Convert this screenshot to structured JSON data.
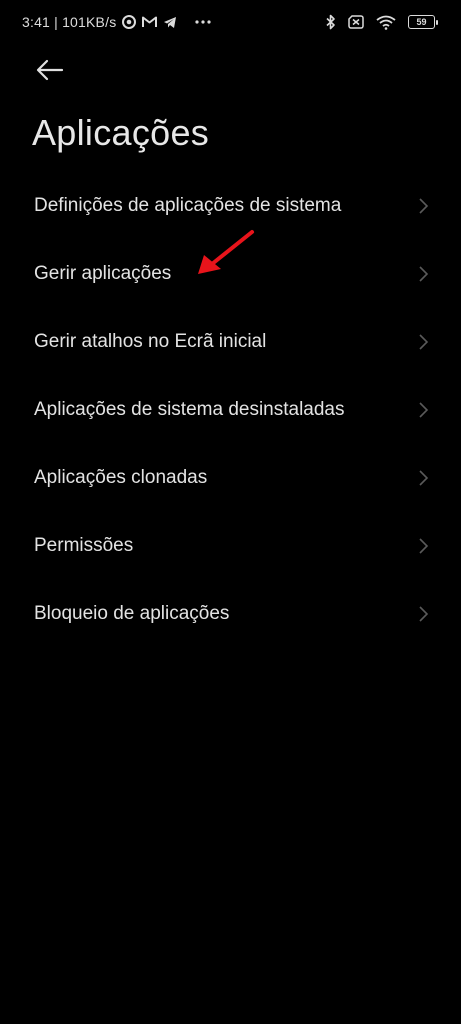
{
  "status_bar": {
    "time_speed": "3:41 | 101KB/s",
    "battery_level": "59",
    "icons": [
      "chrome-icon",
      "gmail-icon",
      "telegram-icon",
      "more-dots-icon",
      "bluetooth-icon",
      "no-sim-icon",
      "wifi-icon",
      "battery-icon"
    ]
  },
  "header": {
    "back_icon": "back-arrow-icon",
    "title": "Aplicações"
  },
  "menu": {
    "items": [
      {
        "label": "Definições de aplicações de sistema"
      },
      {
        "label": "Gerir aplicações"
      },
      {
        "label": "Gerir atalhos no Ecrã inicial"
      },
      {
        "label": "Aplicações de sistema desinstaladas"
      },
      {
        "label": "Aplicações clonadas"
      },
      {
        "label": "Permissões"
      },
      {
        "label": "Bloqueio de aplicações"
      }
    ]
  },
  "colors": {
    "background": "#000000",
    "text": "#e3e3e3",
    "chevron": "#5a5a5a",
    "annotation_arrow": "#e8141b"
  }
}
